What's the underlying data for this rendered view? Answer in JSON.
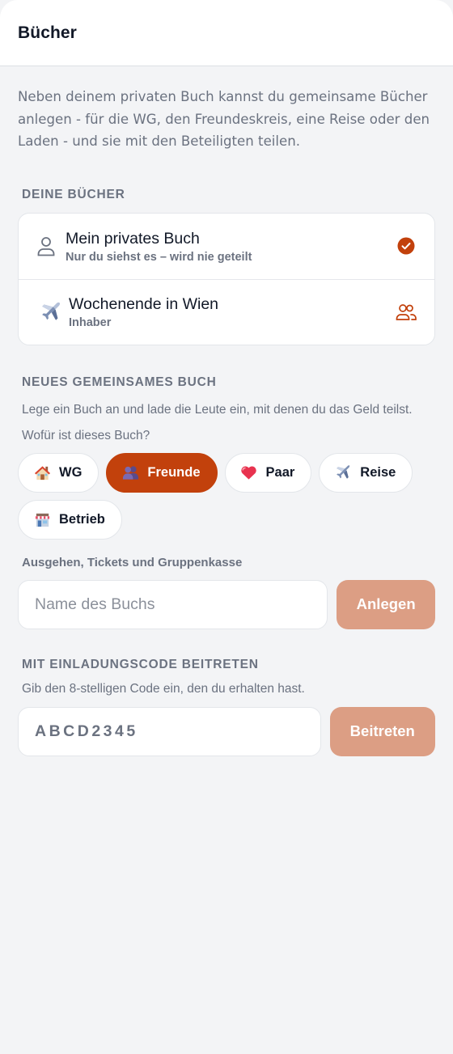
{
  "header": {
    "title": "Bücher"
  },
  "intro": "Neben deinem privaten Buch kannst du gemeinsame Bücher anlegen - für die WG, den Freundeskreis, eine Reise oder den Laden - und sie mit den Beteiligten teilen.",
  "books_section": {
    "title": "DEINE BÜCHER",
    "items": [
      {
        "title": "Mein privates Buch",
        "subtitle": "Nur du siehst es – wird nie geteilt",
        "icon": "person-icon",
        "status_icon": "check-circle-icon"
      },
      {
        "title": "Wochenende in Wien",
        "subtitle": "Inhaber",
        "icon": "airplane-icon",
        "status_icon": "people-icon"
      }
    ]
  },
  "new_section": {
    "title": "NEUES GEMEINSAMES BUCH",
    "help": "Lege ein Buch an und lade die Leute ein, mit denen du das Geld teilst.",
    "question": "Wofür ist dieses Buch?",
    "categories": [
      {
        "label": "WG",
        "icon": "house-icon",
        "selected": false
      },
      {
        "label": "Freunde",
        "icon": "people-icon",
        "selected": true
      },
      {
        "label": "Paar",
        "icon": "heart-icon",
        "selected": false
      },
      {
        "label": "Reise",
        "icon": "airplane-icon",
        "selected": false
      },
      {
        "label": "Betrieb",
        "icon": "shop-icon",
        "selected": false
      }
    ],
    "category_description": "Ausgehen, Tickets und Gruppenkasse",
    "name_placeholder": "Name des Buchs",
    "create_label": "Anlegen"
  },
  "join_section": {
    "title": "MIT EINLADUNGSCODE BEITRETEN",
    "help": "Gib den 8-stelligen Code ein, den du erhalten hast.",
    "code_placeholder": "ABCD2345",
    "join_label": "Beitreten"
  },
  "colors": {
    "accent": "#c2410c",
    "button_disabled": "#dc9e84",
    "background": "#f3f4f6",
    "muted_text": "#6b7280"
  }
}
